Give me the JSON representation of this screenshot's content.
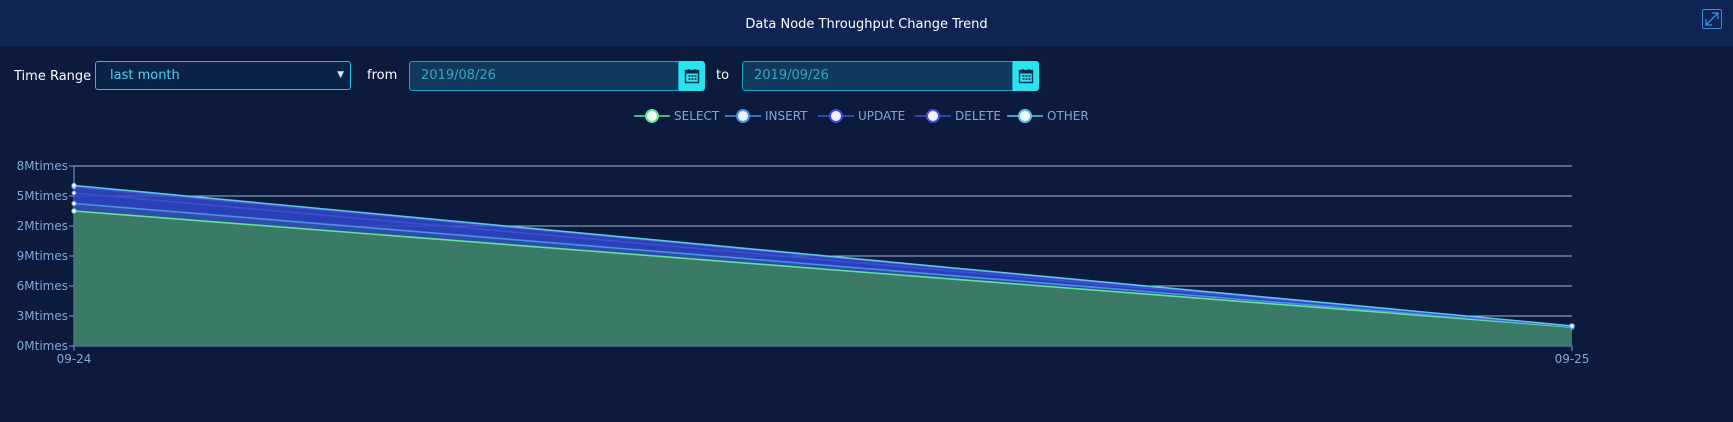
{
  "header": {
    "title": "Data Node Throughput Change Trend"
  },
  "controls": {
    "time_range_label": "Time Range",
    "time_range_value": "last month",
    "from_label": "from",
    "from_value": "2019/08/26",
    "to_label": "to",
    "to_value": "2019/09/26"
  },
  "icons": {
    "expand": "expand-icon",
    "calendar": "calendar-icon",
    "dropdown": "caret-down-icon"
  },
  "colors": {
    "background": "#0b1a3d",
    "header": "#102454",
    "accent": "#27e4f0",
    "select_line": "#5fe39a",
    "insert_line": "#4a90e8",
    "update_line": "#3b4fd6",
    "delete_line": "#4650d4",
    "other_line": "#5cc6e4"
  },
  "chart_data": {
    "type": "area",
    "x": [
      "09-24",
      "09-25"
    ],
    "y_tick_labels": [
      "0Mtimes",
      "3Mtimes",
      "6Mtimes",
      "9Mtimes",
      "2Mtimes",
      "5Mtimes",
      "8Mtimes"
    ],
    "ylim": [
      0,
      6
    ],
    "grid": true,
    "legend_position": "top-center",
    "series": [
      {
        "name": "SELECT",
        "values": [
          4.5,
          0.63
        ]
      },
      {
        "name": "INSERT",
        "values": [
          4.75,
          0.65
        ]
      },
      {
        "name": "UPDATE",
        "values": [
          5.1,
          0.66
        ]
      },
      {
        "name": "DELETE",
        "values": [
          5.3,
          0.66
        ]
      },
      {
        "name": "OTHER",
        "values": [
          5.35,
          0.67
        ]
      }
    ]
  }
}
